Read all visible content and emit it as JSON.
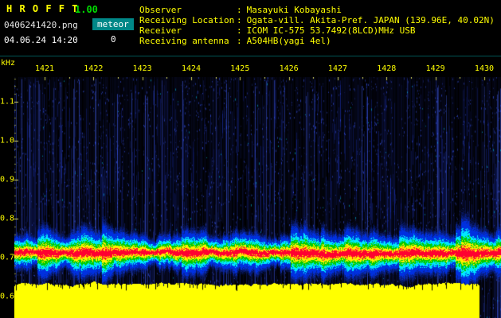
{
  "header": {
    "app_name": "H R O F F T",
    "version": "1.00",
    "filename": "0406241420.png",
    "mode_label": "meteor",
    "count": "0",
    "datetime": "04.06.24 14:20"
  },
  "info": {
    "colon": ":",
    "rows": [
      {
        "label": "Observer",
        "value": "Masayuki Kobayashi"
      },
      {
        "label": "Receiving Location",
        "value": "Ogata-vill. Akita-Pref. JAPAN (139.96E, 40.02N)"
      },
      {
        "label": "Receiver",
        "value": "ICOM IC-575 53.7492(8LCD)MHz USB"
      },
      {
        "label": "Receiving antenna",
        "value": "A504HB(yagi 4el)"
      }
    ]
  },
  "chart": {
    "type": "heatmap",
    "y_unit": "kHz",
    "y_ticks": [
      "1.1",
      "1.0",
      "0.9",
      "0.8",
      "0.7",
      "0.6"
    ],
    "x_ticks": [
      "1421",
      "1422",
      "1423",
      "1424",
      "1425",
      "1426",
      "1427",
      "1428",
      "1429",
      "1430"
    ],
    "colors": {
      "background": "#000000",
      "axis_text": "#ffff00",
      "noise_blue": "#2840dc",
      "band_core_red": "#ff0030",
      "band_yellow": "#ffee00",
      "band_green": "#00cc00",
      "band_cyan": "#00e8ff",
      "band_blue": "#0030e0",
      "meter_yellow": "#ffff00",
      "badge_teal": "#008888"
    }
  }
}
